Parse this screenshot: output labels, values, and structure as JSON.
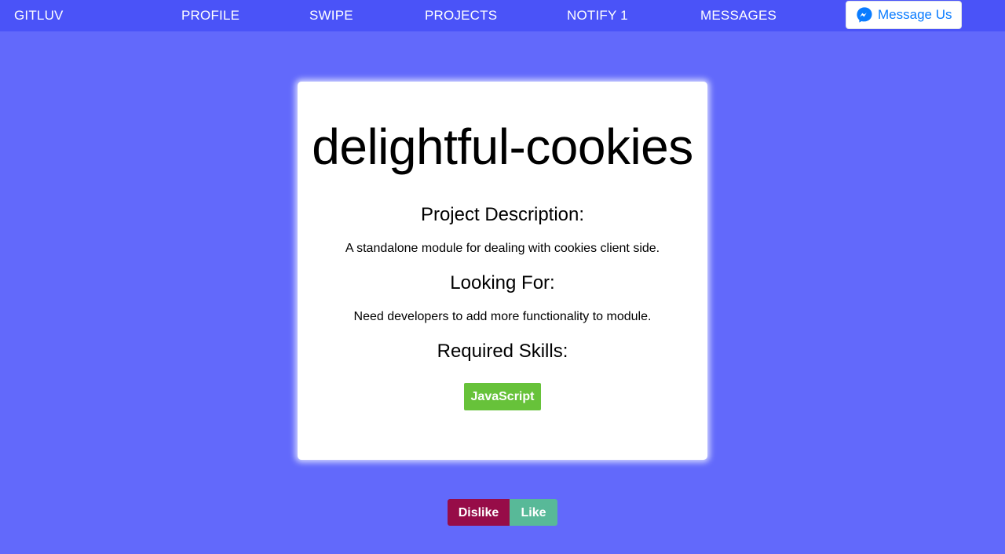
{
  "nav": {
    "brand": "GITLUV",
    "links": [
      "PROFILE",
      "SWIPE",
      "PROJECTS",
      "NOTIFY 1",
      "MESSAGES"
    ],
    "messenger_label": "Message Us",
    "messenger_icon": "messenger-icon"
  },
  "project": {
    "title": "delightful-cookies",
    "description_heading": "Project Description:",
    "description": "A standalone module for dealing with cookies client side.",
    "looking_for_heading": "Looking For:",
    "looking_for": "Need developers to add more functionality to module.",
    "skills_heading": "Required Skills:",
    "skills": [
      "JavaScript"
    ]
  },
  "actions": {
    "dislike_label": "Dislike",
    "like_label": "Like"
  },
  "colors": {
    "background": "#6269fb",
    "navbar": "#4a53f8",
    "skill_tag": "#67c23a",
    "dislike": "#970c48",
    "like": "#58b998",
    "messenger_text": "#0a7cff"
  }
}
